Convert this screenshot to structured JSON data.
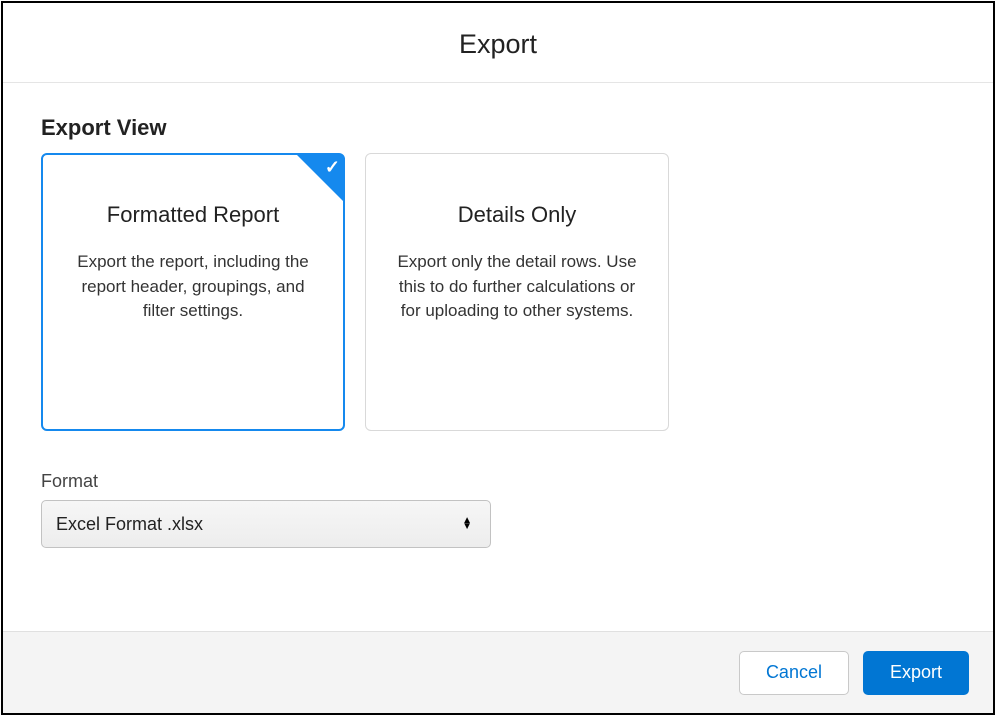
{
  "dialog": {
    "title": "Export"
  },
  "exportView": {
    "sectionTitle": "Export View",
    "options": [
      {
        "title": "Formatted Report",
        "description": "Export the report, including the report header, groupings, and filter settings.",
        "selected": true
      },
      {
        "title": "Details Only",
        "description": "Export only the detail rows. Use this to do further calculations or for uploading to other systems.",
        "selected": false
      }
    ]
  },
  "format": {
    "label": "Format",
    "selected": "Excel Format .xlsx"
  },
  "footer": {
    "cancel": "Cancel",
    "export": "Export"
  }
}
